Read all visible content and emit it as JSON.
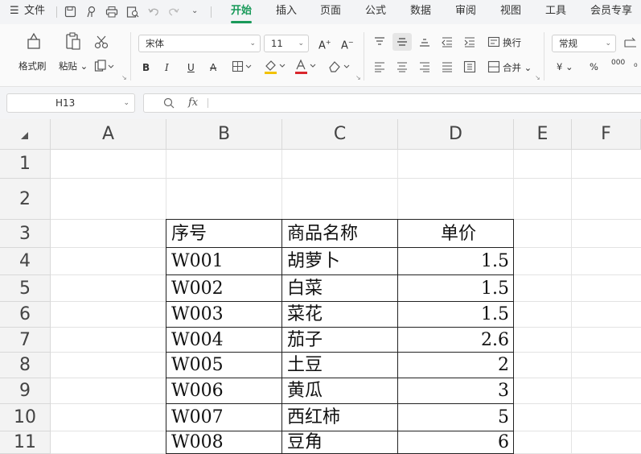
{
  "menu": {
    "file_label": "文件",
    "tabs": [
      "开始",
      "插入",
      "页面",
      "公式",
      "数据",
      "审阅",
      "视图",
      "工具",
      "会员专享"
    ],
    "active_tab": "开始"
  },
  "ribbon": {
    "format_painter": "格式刷",
    "paste": "粘贴",
    "font_name": "宋体",
    "font_size": "11",
    "wrap_text": "换行",
    "merge": "合并",
    "number_format": "常规",
    "bold": "B",
    "italic": "I",
    "underline": "U",
    "strike": "A",
    "currency": "¥",
    "percent": "%",
    "thousands": "000"
  },
  "formula_bar": {
    "name_box": "H13",
    "fx": "fx",
    "formula": ""
  },
  "sheet": {
    "columns": [
      "A",
      "B",
      "C",
      "D",
      "E",
      "F"
    ],
    "rows": [
      "1",
      "2",
      "3",
      "4",
      "5",
      "6",
      "7",
      "8",
      "9",
      "10",
      "11"
    ],
    "table_header": [
      "序号",
      "商品名称",
      "单价"
    ],
    "table_rows": [
      [
        "W001",
        "胡萝卜",
        "1.5"
      ],
      [
        "W002",
        "白菜",
        "1.5"
      ],
      [
        "W003",
        "菜花",
        "1.5"
      ],
      [
        "W004",
        "茄子",
        "2.6"
      ],
      [
        "W005",
        "土豆",
        "2"
      ],
      [
        "W006",
        "黄瓜",
        "3"
      ],
      [
        "W007",
        "西红柿",
        "5"
      ],
      [
        "W008",
        "豆角",
        "6"
      ]
    ]
  },
  "colors": {
    "accent": "#1a9a5a",
    "fill_color": "#f2c200",
    "font_color": "#d9262c"
  }
}
